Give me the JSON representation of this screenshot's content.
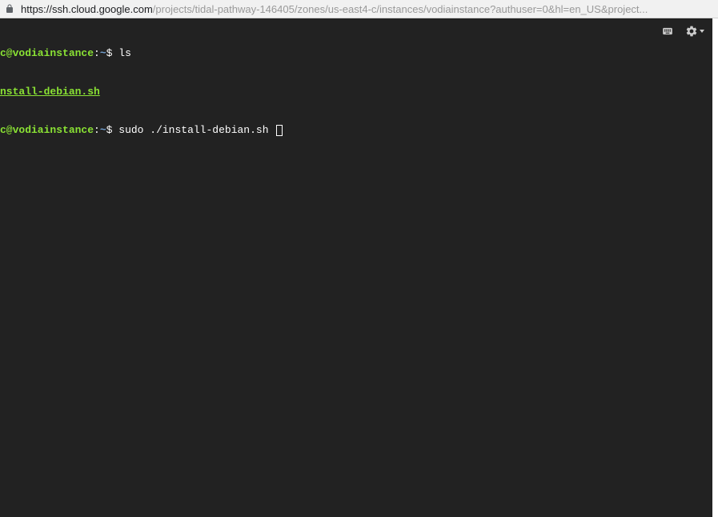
{
  "address_bar": {
    "protocol": "https://",
    "host": "ssh.cloud.google.com",
    "path": "/projects/tidal-pathway-146405/zones/us-east4-c/instances/vodiainstance?authuser=0&hl=en_US&project..."
  },
  "terminal": {
    "lines": [
      {
        "prompt_user": "c@vodiainstance",
        "prompt_colon": ":",
        "prompt_path": "~",
        "prompt_dollar": "$ ",
        "command": "ls"
      },
      {
        "file": "nstall-debian.sh"
      },
      {
        "prompt_user": "c@vodiainstance",
        "prompt_colon": ":",
        "prompt_path": "~",
        "prompt_dollar": "$ ",
        "command": "sudo ./install-debian.sh ",
        "cursor": true
      }
    ]
  },
  "toolbar": {
    "keyboard_icon": "keyboard",
    "gear_icon": "settings"
  }
}
